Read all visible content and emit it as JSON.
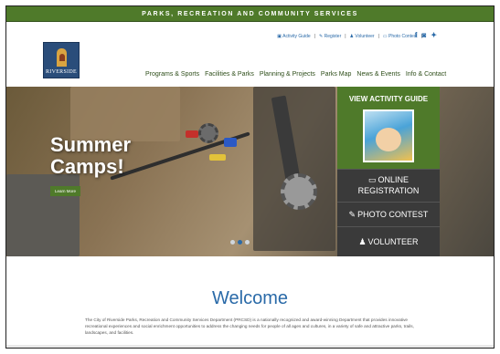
{
  "topbar": {
    "title": "PARKS, RECREATION AND COMMUNITY SERVICES"
  },
  "logo": {
    "text": "RIVERSIDE"
  },
  "utility": {
    "items": [
      "Activity Guide",
      "Register",
      "Volunteer",
      "Photo Contest"
    ],
    "separator": "|"
  },
  "social": {
    "facebook": "f",
    "instagram": "◙",
    "twitter": "✦"
  },
  "nav": {
    "items": [
      "Programs & Sports",
      "Facilities & Parks",
      "Planning & Projects",
      "Parks Map",
      "News & Events",
      "Info & Contact"
    ]
  },
  "hero": {
    "headline_line1": "Summer",
    "headline_line2": "Camps!",
    "cta": "Learn More",
    "slides": 3,
    "active_slide": 2
  },
  "panel": {
    "activity_title": "VIEW ACTIVITY GUIDE",
    "online_line1": "ONLINE",
    "online_line2": "REGISTRATION",
    "photo": "PHOTO CONTEST",
    "volunteer": "VOLUNTEER"
  },
  "welcome": {
    "title": "Welcome",
    "text": "The City of Riverside Parks, Recreation and Community Services Department (PRCSD) is a nationally recognized and award-winning Department that provides innovative recreational experiences and social enrichment opportunities to address the changing needs for people of all ages and cultures, in a variety of safe and attractive parks, trails, landscapes, and facilities."
  },
  "colors": {
    "brand_green": "#4f7a2a",
    "link_blue": "#2a6aa8",
    "panel_dark": "#3a3a3a"
  }
}
